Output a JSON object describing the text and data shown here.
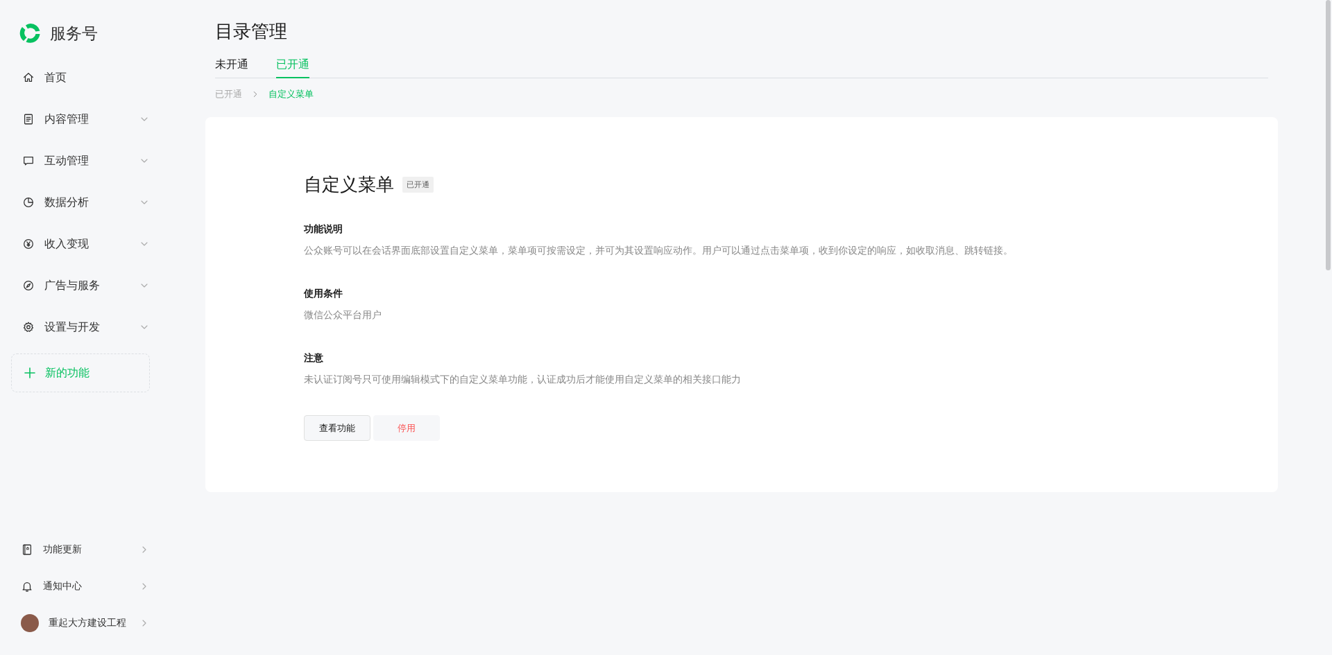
{
  "brand": {
    "name": "服务号"
  },
  "nav": [
    {
      "label": "首页",
      "kind": "link"
    },
    {
      "label": "内容管理",
      "kind": "group",
      "expanded": false
    },
    {
      "label": "互动管理",
      "kind": "group",
      "expanded": false
    },
    {
      "label": "数据分析",
      "kind": "group",
      "expanded": false
    },
    {
      "label": "收入变现",
      "kind": "group",
      "expanded": false
    },
    {
      "label": "广告与服务",
      "kind": "group",
      "expanded": false
    },
    {
      "label": "设置与开发",
      "kind": "group",
      "expanded": false
    }
  ],
  "new_feature": {
    "label": "新的功能"
  },
  "footer_nav": [
    {
      "label": "功能更新",
      "kind": "item"
    },
    {
      "label": "通知中心",
      "kind": "item"
    },
    {
      "label": "重起大方建设工程",
      "kind": "account"
    }
  ],
  "page": {
    "title": "目录管理",
    "tabs": [
      {
        "label": "未开通",
        "selected": false
      },
      {
        "label": "已开通",
        "selected": true
      }
    ],
    "breadcrumb": [
      "已开通",
      "自定义菜单"
    ],
    "card": {
      "title": "自定义菜单",
      "badge": "已开通",
      "sections": [
        {
          "heading": "功能说明",
          "text": "公众账号可以在会话界面底部设置自定义菜单，菜单项可按需设定，并可为其设置响应动作。用户可以通过点击菜单项，收到你设定的响应，如收取消息、跳转链接。"
        },
        {
          "heading": "使用条件",
          "text": "微信公众平台用户"
        },
        {
          "heading": "注意",
          "text": "未认证订阅号只可使用编辑模式下的自定义菜单功能，认证成功后才能使用自定义菜单的相关接口能力"
        }
      ],
      "buttons": [
        {
          "label": "查看功能",
          "kind": "default"
        },
        {
          "label": "停用",
          "kind": "danger"
        }
      ]
    }
  }
}
